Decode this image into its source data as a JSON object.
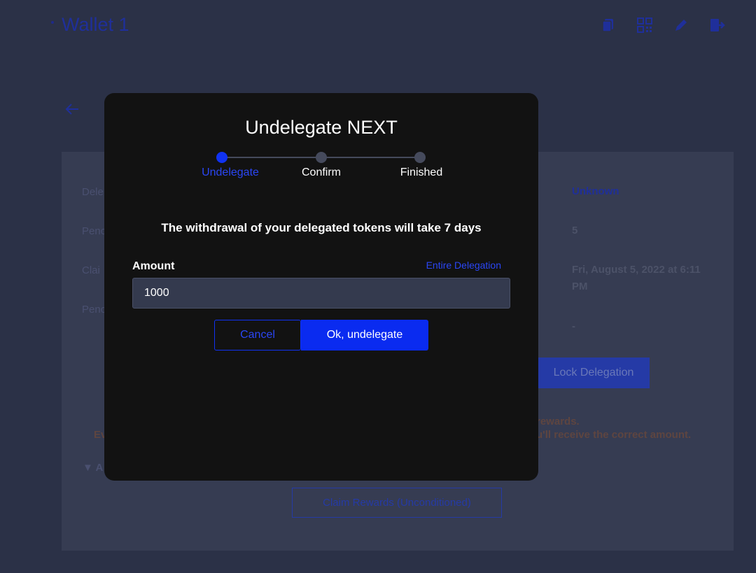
{
  "header": {
    "wallet_title": "Wallet 1",
    "icons": [
      "copy-icon",
      "qr-code-icon",
      "edit-icon",
      "logout-icon"
    ]
  },
  "background": {
    "labels": [
      "Dele",
      "Penc",
      "Clai",
      "Penc"
    ],
    "values": {
      "status": "Unknown",
      "count": "5",
      "claim_date": "Fri, August 5, 2022 at 6:11 PM",
      "pending": "-"
    },
    "lock_button": "Lock Delegation",
    "warning_line1_start": "rewards.",
    "warning_line2_left": "Ev",
    "warning_line2_right": "u'll receive the correct amount.",
    "advanced_toggle": "▼ A",
    "claim_button": "Claim Rewards (Unconditioned)"
  },
  "modal": {
    "title": "Undelegate NEXT",
    "steps": [
      {
        "label": "Undelegate",
        "active": true
      },
      {
        "label": "Confirm",
        "active": false
      },
      {
        "label": "Finished",
        "active": false
      }
    ],
    "notice": "The withdrawal of your delegated tokens will take 7 days",
    "amount_label": "Amount",
    "entire_link": "Entire Delegation",
    "amount_value": "1000",
    "cancel_label": "Cancel",
    "ok_label": "Ok, undelegate"
  },
  "colors": {
    "accent": "#1032f2",
    "backdrop": "#2b3147",
    "modal_bg": "#121212",
    "input_bg": "#343a4e"
  }
}
